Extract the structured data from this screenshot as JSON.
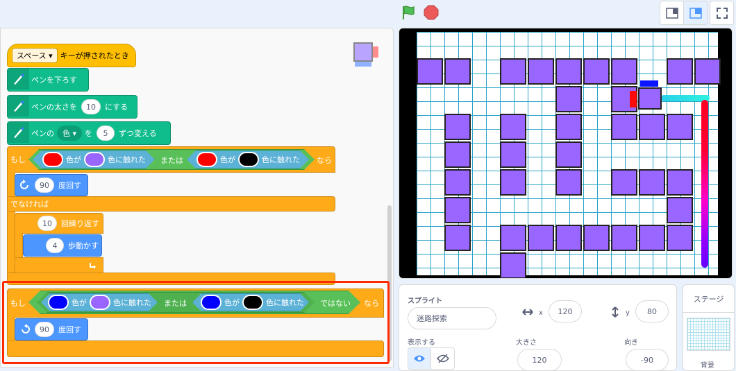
{
  "event_block": {
    "key": "スペース",
    "label": "キーが押されたとき"
  },
  "pen_down": {
    "label": "ペンを下ろす"
  },
  "pen_size": {
    "label_a": "ペンの太さを",
    "value": "10",
    "label_b": "にする"
  },
  "pen_change": {
    "label_a": "ペンの",
    "param": "色",
    "label_b": "を",
    "value": "5",
    "label_c": "ずつ変える"
  },
  "if1": {
    "moshi": "もし",
    "ga": "色が",
    "touch": "色に触れた",
    "or": "または",
    "nara": "なら",
    "c1": "#ff0000",
    "c2": "#9966ff",
    "c3": "#ff0000",
    "c4": "#000000"
  },
  "turn1": {
    "value": "90",
    "label": "度回す"
  },
  "else_label": "でなければ",
  "repeat": {
    "value": "10",
    "label": "回繰り返す"
  },
  "move": {
    "value": "4",
    "label": "歩動かす"
  },
  "if2": {
    "moshi": "もし",
    "ga": "色が",
    "touch": "色に触れた",
    "or": "または",
    "not": "ではない",
    "nara": "なら",
    "c1": "#0000ff",
    "c2": "#9966ff",
    "c3": "#0000ff",
    "c4": "#000000"
  },
  "turn2": {
    "value": "90",
    "label": "度回す"
  },
  "sprite_pane": {
    "sprite_label": "スプライト",
    "sprite_name": "迷路探索",
    "x_label": "x",
    "x_value": "120",
    "y_label": "y",
    "y_value": "80",
    "show_label": "表示する",
    "size_label": "大きさ",
    "size_value": "120",
    "direction_label": "向き",
    "direction_value": "-90"
  },
  "stage_pane": {
    "title": "ステージ",
    "backdrop_label": "背景"
  },
  "colors": {
    "highlight": "#ff2a00",
    "wall": "#9966ff"
  }
}
